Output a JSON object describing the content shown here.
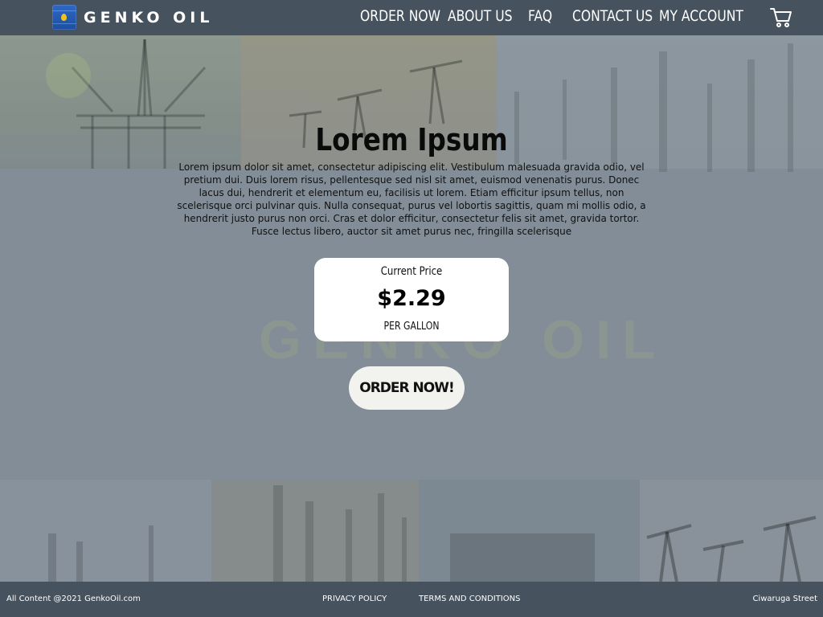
{
  "header": {
    "logo_text": "GENKO OIL",
    "nav": [
      {
        "label": "ORDER NOW"
      },
      {
        "label": "ABOUT US"
      },
      {
        "label": "FAQ"
      },
      {
        "label": "CONTACT US"
      },
      {
        "label": "MY ACCOUNT"
      }
    ],
    "cart_icon": "shopping-cart-icon"
  },
  "hero": {
    "title": "Lorem Ipsum",
    "body": "Lorem ipsum dolor sit amet, consectetur adipiscing elit. Vestibulum malesuada gravida odio, vel pretium dui. Duis lorem risus, pellentesque sed nisl sit amet, euismod venenatis purus. Donec lacus dui, hendrerit et elementum eu, facilisis ut lorem. Etiam efficitur ipsum tellus, non scelerisque orci pulvinar quis. Nulla consequat, purus vel lobortis sagittis, quam mi mollis odio, a hendrerit justo purus non orci. Cras et dolor efficitur, consectetur felis sit amet, gravida tortor. Fusce lectus libero, auctor sit amet purus nec, fringilla scelerisque",
    "watermark": "GENKO OIL"
  },
  "price_card": {
    "label": "Current Price",
    "value": "$2.29",
    "unit": "PER GALLON"
  },
  "order_button": {
    "label": "ORDER NOW!"
  },
  "footer": {
    "copyright": "All Content @2021 GenkoOil.com",
    "links": [
      {
        "label": "PRIVACY POLICY"
      },
      {
        "label": "TERMS AND CONDITIONS"
      }
    ],
    "address": "Ciwaruga Street"
  },
  "colors": {
    "header_bg": "#46525d",
    "footer_bg": "#46525d",
    "logo_blue": "#1b4fa0",
    "logo_drop": "#f4c21c",
    "card_bg": "#ffffff",
    "button_bg": "#f2f2ee"
  }
}
